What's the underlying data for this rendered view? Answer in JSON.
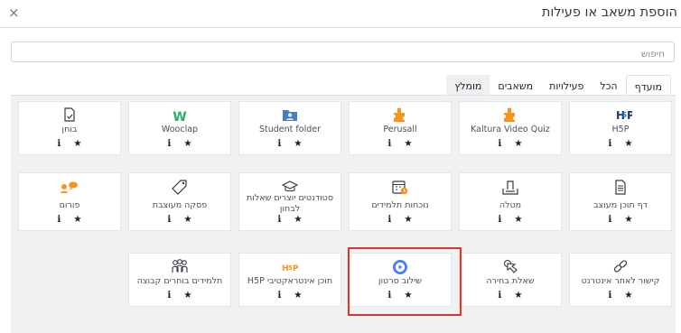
{
  "dialog": {
    "close_glyph": "×",
    "title": "הוספת משאב או פעילות"
  },
  "search": {
    "placeholder": "חיפוש"
  },
  "tabs": [
    {
      "label": "מועדף",
      "active": true
    },
    {
      "label": "הכל"
    },
    {
      "label": "פעילויות"
    },
    {
      "label": "משאבים"
    },
    {
      "label": "מומלץ",
      "shaded": true
    }
  ],
  "actions": {
    "info_glyph": "ℹ",
    "star_glyph": "★"
  },
  "tiles": [
    {
      "label": "H5P",
      "icon": "h5p-icon"
    },
    {
      "label": "Kaltura Video Quiz",
      "icon": "puzzle-piece-icon"
    },
    {
      "label": "Perusall",
      "icon": "puzzle-piece-icon"
    },
    {
      "label": "Student folder",
      "icon": "student-folder-icon"
    },
    {
      "label": "Wooclap",
      "icon": "wooclap-w-icon",
      "icon_text": "W"
    },
    {
      "label": "בוחן",
      "icon": "quiz-icon"
    },
    {
      "label": "דף תוכן מעוצב",
      "icon": "page-document-icon"
    },
    {
      "label": "מטלה",
      "icon": "assignment-upload-icon"
    },
    {
      "label": "נוכחות תלמידים",
      "icon": "attendance-calendar-icon"
    },
    {
      "label": "סטודנטים יוצרים שאלות לבחון",
      "icon": "graduation-cap-icon"
    },
    {
      "label": "פסקה מעוצבת",
      "icon": "label-tag-icon"
    },
    {
      "label": "פורום",
      "icon": "forum-chat-icon"
    },
    {
      "label": "קישור לאתר אינטרנט",
      "icon": "link-icon"
    },
    {
      "label": "שאלת בחירה",
      "icon": "choice-hand-icon"
    },
    {
      "label": "שילוב סרטון",
      "icon": "play-video-icon"
    },
    {
      "label": "תוכן אינטראקטיבי H5P",
      "icon": "h5p-interactive-icon"
    },
    {
      "label": "תלמידים בוחרים קבוצה",
      "icon": "group-choice-icon"
    }
  ],
  "colors": {
    "highlight": "#e0342a",
    "accent_orange": "#f7941d",
    "h5p_blue": "#1a73d9",
    "wooclap_green": "#27b06b",
    "video_blue": "#4a7cf6"
  }
}
